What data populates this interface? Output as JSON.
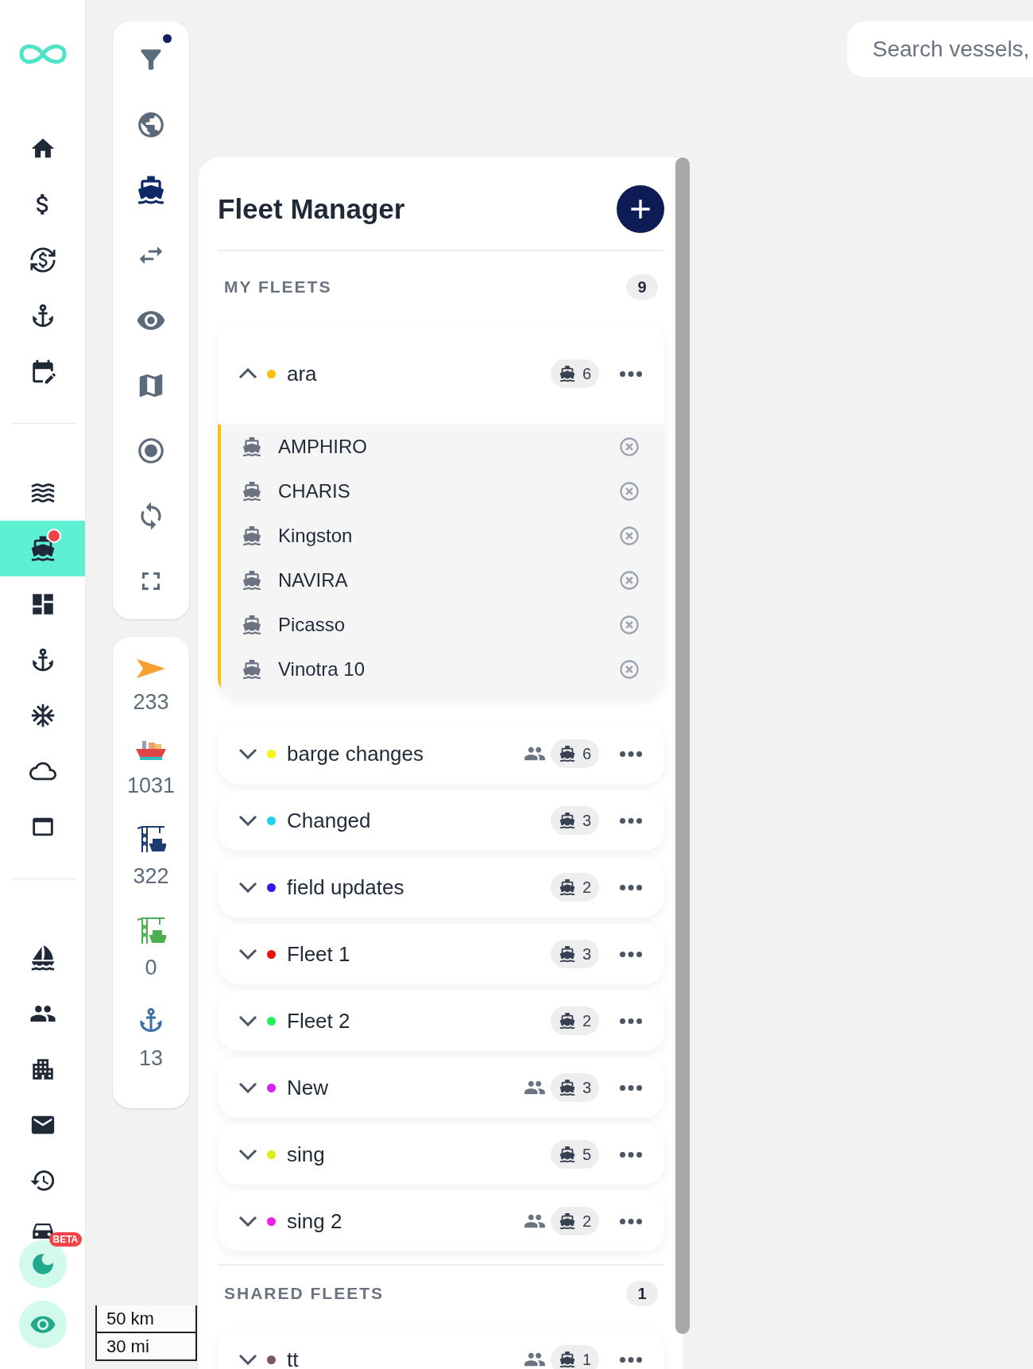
{
  "nav": {
    "groups": [
      [
        {
          "selected": false
        },
        {
          "selected": false
        },
        {
          "selected": false
        },
        {
          "selected": false
        },
        {
          "selected": false
        }
      ],
      [
        {
          "selected": false
        },
        {
          "selected": true,
          "notification": true
        },
        {
          "selected": false
        },
        {
          "selected": false
        },
        {
          "selected": false
        },
        {
          "selected": false
        },
        {
          "selected": false
        }
      ],
      [
        {
          "selected": false
        },
        {
          "selected": false
        },
        {
          "selected": false
        },
        {
          "selected": false
        },
        {
          "selected": false
        },
        {
          "selected": false
        }
      ]
    ],
    "beta_badge": "BETA"
  },
  "toolbar": {
    "filter_active": true,
    "items": [
      {
        "selected": false
      },
      {
        "selected": false
      },
      {
        "selected": true
      },
      {
        "selected": false
      },
      {
        "selected": false
      },
      {
        "selected": false
      },
      {
        "selected": false
      },
      {
        "selected": false
      },
      {
        "selected": false
      }
    ]
  },
  "stats": [
    {
      "kind": "moving",
      "value": "233"
    },
    {
      "kind": "cargo",
      "value": "1031"
    },
    {
      "kind": "port",
      "value": "322"
    },
    {
      "kind": "port_green",
      "value": "0"
    },
    {
      "kind": "anchor",
      "value": "13"
    }
  ],
  "search": {
    "placeholder": "Search vessels,"
  },
  "scale": {
    "metric": "50 km",
    "imperial": "30 mi"
  },
  "fleet_manager": {
    "title": "Fleet Manager",
    "my_fleets": {
      "label": "MY FLEETS",
      "count": "9",
      "fleets": [
        {
          "name": "ara",
          "color": "#fbbf0c",
          "count": "6",
          "shared": false,
          "expanded": true,
          "vessels": [
            "AMPHIRO",
            "CHARIS",
            "Kingston",
            "NAVIRA",
            "Picasso",
            "Vinotra 10"
          ]
        },
        {
          "name": "barge changes",
          "color": "#f5f516",
          "count": "6",
          "shared": true,
          "expanded": false
        },
        {
          "name": "Changed",
          "color": "#22d3ee",
          "count": "3",
          "shared": false,
          "expanded": false
        },
        {
          "name": "field updates",
          "color": "#3b12f0",
          "count": "2",
          "shared": false,
          "expanded": false
        },
        {
          "name": "Fleet 1",
          "color": "#f01010",
          "count": "3",
          "shared": false,
          "expanded": false
        },
        {
          "name": "Fleet 2",
          "color": "#1ff05a",
          "count": "2",
          "shared": false,
          "expanded": false
        },
        {
          "name": "New",
          "color": "#d91ef0",
          "count": "3",
          "shared": true,
          "expanded": false
        },
        {
          "name": "sing",
          "color": "#dcf016",
          "count": "5",
          "shared": false,
          "expanded": false
        },
        {
          "name": "sing 2",
          "color": "#f01ee6",
          "count": "2",
          "shared": true,
          "expanded": false
        }
      ]
    },
    "shared_fleets": {
      "label": "SHARED FLEETS",
      "count": "1",
      "fleets": [
        {
          "name": "tt",
          "color": "#7a5a55",
          "count": "1",
          "shared": true,
          "expanded": false
        }
      ]
    }
  }
}
